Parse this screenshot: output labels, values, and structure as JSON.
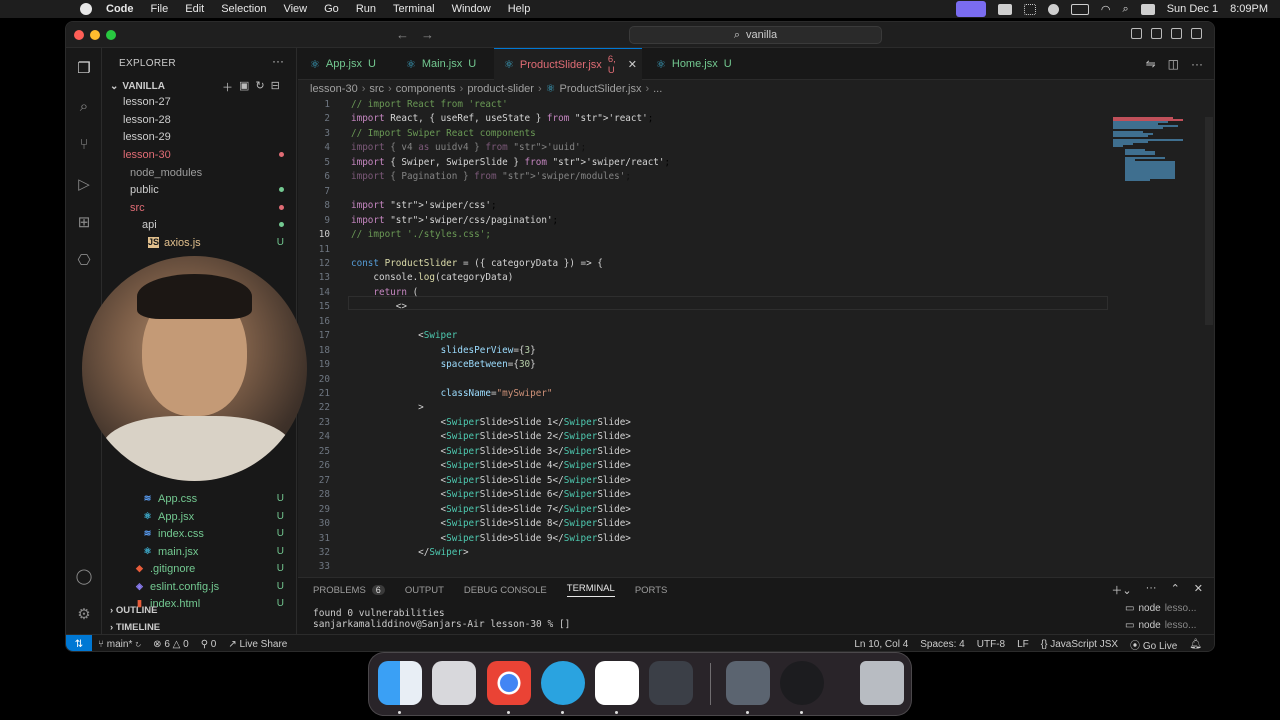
{
  "menubar": {
    "app": "Code",
    "items": [
      "File",
      "Edit",
      "Selection",
      "View",
      "Go",
      "Run",
      "Terminal",
      "Window",
      "Help"
    ],
    "date": "Sun Dec 1",
    "time": "8:09PM"
  },
  "titlebar": {
    "search": "vanilla"
  },
  "sidebar": {
    "title": "EXPLORER",
    "root": "VANILLA",
    "items": [
      {
        "label": "lesson-27",
        "color": "#cccccc"
      },
      {
        "label": "lesson-28",
        "color": "#cccccc"
      },
      {
        "label": "lesson-29",
        "color": "#cccccc"
      },
      {
        "label": "lesson-30",
        "color": "#e06c75"
      },
      {
        "label": "node_modules",
        "color": "#9d9d9d"
      },
      {
        "label": "public",
        "color": "#cccccc"
      },
      {
        "label": "src",
        "color": "#e06c75"
      },
      {
        "label": "api",
        "color": "#cccccc"
      },
      {
        "label": "axios.js",
        "color": "#e2c08d",
        "status": "U"
      },
      {
        "label": "App.css",
        "color": "#73c991",
        "status": "U"
      },
      {
        "label": "App.jsx",
        "color": "#73c991",
        "status": "U"
      },
      {
        "label": "index.css",
        "color": "#73c991",
        "status": "U"
      },
      {
        "label": "main.jsx",
        "color": "#73c991",
        "status": "U"
      },
      {
        "label": ".gitignore",
        "color": "#73c991",
        "status": "U"
      },
      {
        "label": "eslint.config.js",
        "color": "#73c991",
        "status": "U"
      },
      {
        "label": "index.html",
        "color": "#73c991",
        "status": "U"
      }
    ],
    "outline": "OUTLINE",
    "timeline": "TIMELINE"
  },
  "tabs": [
    {
      "label": "App.jsx",
      "status": "U"
    },
    {
      "label": "Main.jsx",
      "status": "U"
    },
    {
      "label": "ProductSlider.jsx",
      "status": "6, U",
      "active": true
    },
    {
      "label": "Home.jsx",
      "status": "U"
    }
  ],
  "breadcrumb": [
    "lesson-30",
    "src",
    "components",
    "product-slider",
    "ProductSlider.jsx",
    "..."
  ],
  "code": [
    "// import React from 'react'",
    "import React, { useRef, useState } from 'react';",
    "// Import Swiper React components",
    "import { v4 as uuidv4 } from 'uuid';",
    "import { Swiper, SwiperSlide } from 'swiper/react';",
    "import { Pagination } from 'swiper/modules';",
    "",
    "import 'swiper/css';",
    "import 'swiper/css/pagination';",
    "// import './styles.css';",
    "",
    "const ProductSlider = ({ categoryData }) => {",
    "    console.log(categoryData)",
    "    return (",
    "        <>",
    "",
    "            <Swiper",
    "                slidesPerView={3}",
    "                spaceBetween={30}",
    "",
    "                className=\"mySwiper\"",
    "            >",
    "                <SwiperSlide>Slide 1</SwiperSlide>",
    "                <SwiperSlide>Slide 2</SwiperSlide>",
    "                <SwiperSlide>Slide 3</SwiperSlide>",
    "                <SwiperSlide>Slide 4</SwiperSlide>",
    "                <SwiperSlide>Slide 5</SwiperSlide>",
    "                <SwiperSlide>Slide 6</SwiperSlide>",
    "                <SwiperSlide>Slide 7</SwiperSlide>",
    "                <SwiperSlide>Slide 8</SwiperSlide>",
    "                <SwiperSlide>Slide 9</SwiperSlide>",
    "            </Swiper>",
    ""
  ],
  "line_numbers": [
    "1",
    "2",
    "3",
    "4",
    "5",
    "6",
    "7",
    "8",
    "9",
    "10",
    "11",
    "12",
    "13",
    "14",
    "15",
    "16",
    "17",
    "18",
    "19",
    "20",
    "21",
    "22",
    "23",
    "24",
    "25",
    "26",
    "27",
    "28",
    "29",
    "30",
    "31",
    "32",
    "33"
  ],
  "panel": {
    "tabs": [
      "PROBLEMS",
      "OUTPUT",
      "DEBUG CONSOLE",
      "TERMINAL",
      "PORTS"
    ],
    "problems_count": "6",
    "terminal_lines": [
      "found 0 vulnerabilities",
      "sanjarkamaliddinov@Sanjars-Air lesson-30 % []"
    ],
    "terminals": [
      {
        "name": "node",
        "sub": "lesso..."
      },
      {
        "name": "node",
        "sub": "lesso..."
      }
    ]
  },
  "statusbar": {
    "branch": "main*",
    "errors": "6",
    "warnings": "0",
    "ports": "0",
    "live_share": "Live Share",
    "position": "Ln 10, Col 4",
    "spaces": "Spaces: 4",
    "encoding": "UTF-8",
    "eol": "LF",
    "language": "JavaScript JSX",
    "golive": "Go Live"
  },
  "dock": [
    "finder-icon",
    "launchpad-icon",
    "chrome-icon",
    "telegram-icon",
    "vscode-icon",
    "davinci-icon",
    "quicktime-icon",
    "obs-icon",
    "trash-icon"
  ],
  "colors": {
    "accent": "#0078d4",
    "modified": "#e06c75",
    "untracked": "#73c991"
  }
}
